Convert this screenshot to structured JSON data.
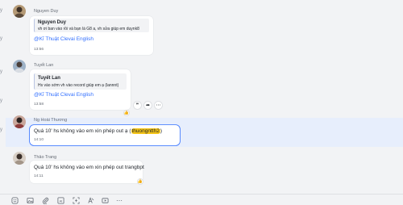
{
  "messages": [
    {
      "sender": "Nguyen Duy",
      "quote_name": "Nguyen Duy",
      "quote_text": "vh ơi ban vào rồi và bạn là G8 a, vh sửa giúp em duynk8",
      "mention": "@Kĩ Thuật Clevai English",
      "time": "13:56"
    },
    {
      "sender": "Tuyết Lan",
      "quote_name": "Tuyết Lan",
      "quote_text": "Hs vào sớm vh vào record giúp em ạ (lannnt)",
      "mention": "@Kĩ Thuật Clevai English",
      "time": "13:58"
    },
    {
      "sender": "Ng Hoài Thương",
      "text": "Quá 10' hs không vào em xin phép out ạ",
      "mention_open": "(",
      "mention_chip": "thuongntth2",
      "mention_close": ")",
      "time": "14:10"
    },
    {
      "sender": "Thảo Trang",
      "text": "Quá 10' hs không vào em xin phép out trangbpt",
      "time": "14:11"
    }
  ],
  "hover_actions": [
    "quote-icon",
    "forward-icon",
    "more-icon"
  ],
  "toolbar_icons": [
    "emoji-icon",
    "image-icon",
    "attachment-icon",
    "screenshot-icon",
    "format-icon",
    "mention-icon",
    "text-style-icon",
    "video-icon",
    "more-icon"
  ],
  "left_rail_marks": [
    "y",
    "y",
    "y",
    "y",
    "y"
  ]
}
